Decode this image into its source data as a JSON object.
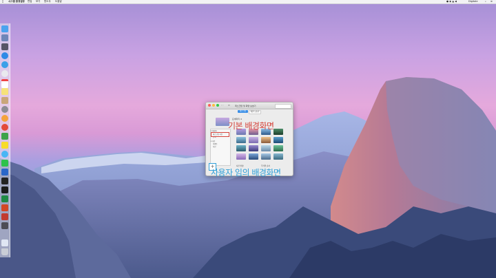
{
  "menubar": {
    "app_name": "시스템 환경설정",
    "menus": [
      "편집",
      "보기",
      "윈도우",
      "도움말"
    ],
    "time": "Digitale"
  },
  "window": {
    "title": "데스크탑 및 화면 보호기",
    "tabs": [
      "데스크탑",
      "화면 보호기"
    ],
    "current_name": "요세미티 4",
    "sidebar": [
      "▾ Apple",
      "데스크탑 사진",
      "단색",
      "▾ 사진",
      "이벤트",
      "사진"
    ],
    "change_picture": "사진 변경:",
    "random_order": "무작위 순서"
  },
  "annotations": {
    "default_label": "기본 배경화면",
    "custom_label": "사용자 임의 배경화면",
    "plus": "+"
  },
  "colors": {
    "annotation_red": "#d5443b",
    "annotation_blue": "#2f9fd8",
    "selection_blue": "#3b8fe6"
  }
}
